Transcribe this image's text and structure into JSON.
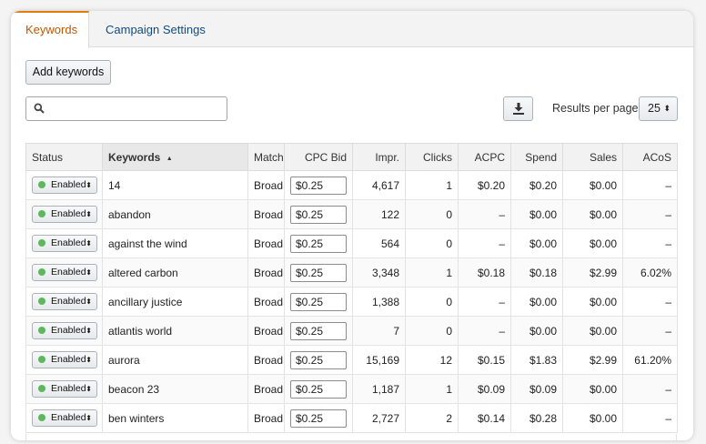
{
  "tabs": [
    {
      "label": "Keywords",
      "active": true
    },
    {
      "label": "Campaign Settings",
      "active": false
    }
  ],
  "toolbar": {
    "add_keywords_label": "Add keywords",
    "search_placeholder": "",
    "results_per_page_label": "Results per page:",
    "results_per_page_value": "25",
    "download_icon": "download-icon"
  },
  "table": {
    "columns": [
      "Status",
      "Keywords",
      "Match",
      "CPC Bid",
      "Impr.",
      "Clicks",
      "ACPC",
      "Spend",
      "Sales",
      "ACoS"
    ],
    "sort_indicator": "▲",
    "rows": [
      {
        "status": "Enabled",
        "keyword": "14",
        "match": "Broad",
        "bid": "$0.25",
        "impr": "4,617",
        "clicks": "1",
        "acpc": "$0.20",
        "spend": "$0.20",
        "sales": "$0.00",
        "acos": "–"
      },
      {
        "status": "Enabled",
        "keyword": "abandon",
        "match": "Broad",
        "bid": "$0.25",
        "impr": "122",
        "clicks": "0",
        "acpc": "–",
        "spend": "$0.00",
        "sales": "$0.00",
        "acos": "–"
      },
      {
        "status": "Enabled",
        "keyword": "against the wind",
        "match": "Broad",
        "bid": "$0.25",
        "impr": "564",
        "clicks": "0",
        "acpc": "–",
        "spend": "$0.00",
        "sales": "$0.00",
        "acos": "–"
      },
      {
        "status": "Enabled",
        "keyword": "altered carbon",
        "match": "Broad",
        "bid": "$0.25",
        "impr": "3,348",
        "clicks": "1",
        "acpc": "$0.18",
        "spend": "$0.18",
        "sales": "$2.99",
        "acos": "6.02%"
      },
      {
        "status": "Enabled",
        "keyword": "ancillary justice",
        "match": "Broad",
        "bid": "$0.25",
        "impr": "1,388",
        "clicks": "0",
        "acpc": "–",
        "spend": "$0.00",
        "sales": "$0.00",
        "acos": "–"
      },
      {
        "status": "Enabled",
        "keyword": "atlantis world",
        "match": "Broad",
        "bid": "$0.25",
        "impr": "7",
        "clicks": "0",
        "acpc": "–",
        "spend": "$0.00",
        "sales": "$0.00",
        "acos": "–"
      },
      {
        "status": "Enabled",
        "keyword": "aurora",
        "match": "Broad",
        "bid": "$0.25",
        "impr": "15,169",
        "clicks": "12",
        "acpc": "$0.15",
        "spend": "$1.83",
        "sales": "$2.99",
        "acos": "61.20%"
      },
      {
        "status": "Enabled",
        "keyword": "beacon 23",
        "match": "Broad",
        "bid": "$0.25",
        "impr": "1,187",
        "clicks": "1",
        "acpc": "$0.09",
        "spend": "$0.09",
        "sales": "$0.00",
        "acos": "–"
      },
      {
        "status": "Enabled",
        "keyword": "ben winters",
        "match": "Broad",
        "bid": "$0.25",
        "impr": "2,727",
        "clicks": "2",
        "acpc": "$0.14",
        "spend": "$0.28",
        "sales": "$0.00",
        "acos": "–"
      }
    ]
  },
  "colors": {
    "active_tab_text": "#c45500",
    "tab_accent": "#e47911",
    "link_blue": "#0f4c81",
    "enabled_dot": "#5cb85c"
  }
}
